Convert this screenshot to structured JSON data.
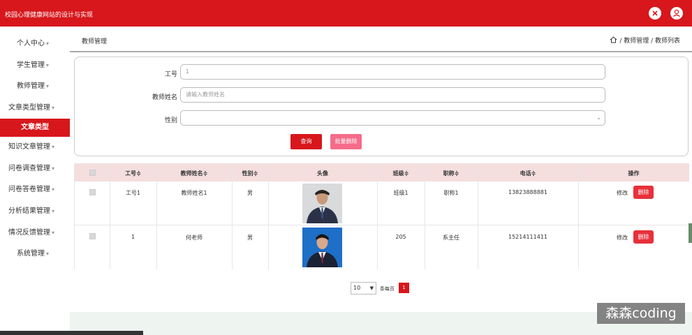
{
  "app": {
    "title": "校园心理健康网站的设计与实现",
    "close_icon": "close-icon",
    "user_icon": "user-icon"
  },
  "sidebar": {
    "items": [
      {
        "label": "个人中心",
        "arrow": "▾"
      },
      {
        "label": "学生管理",
        "arrow": "▾"
      },
      {
        "label": "教师管理",
        "arrow": "▾"
      },
      {
        "label": "文章类型管理",
        "arrow": "▾"
      },
      {
        "label": "文章类型",
        "arrow": ""
      },
      {
        "label": "知识文章管理",
        "arrow": "▾"
      },
      {
        "label": "问卷调查管理",
        "arrow": "▾"
      },
      {
        "label": "问卷答卷管理",
        "arrow": "▾"
      },
      {
        "label": "分析结果管理",
        "arrow": "▾"
      },
      {
        "label": "情况反馈管理",
        "arrow": "▾"
      },
      {
        "label": "系统管理",
        "arrow": "▾"
      }
    ]
  },
  "header": {
    "page_title": "教师管理",
    "breadcrumb": "/ 教师管理 / 教师列表"
  },
  "search": {
    "id_label": "工号",
    "id_value": "1",
    "name_label": "教师姓名",
    "name_placeholder": "请输入教师姓名",
    "gender_label": "性别",
    "gender_value": "",
    "query_button": "查询",
    "batch_delete_button": "批量删除"
  },
  "table": {
    "headers": [
      "工号≑",
      "教师姓名≑",
      "性别≑",
      "头像",
      "班级≑",
      "职称≑",
      "电话≑",
      "操作"
    ],
    "rows": [
      {
        "id": "工号1",
        "name": "教师姓名1",
        "gender": "男",
        "class": "班级1",
        "title": "职称1",
        "phone": "13823888881",
        "edit": "修改",
        "delete": "删除"
      },
      {
        "id": "1",
        "name": "何老师",
        "gender": "男",
        "class": "205",
        "title": "系主任",
        "phone": "15214111411",
        "edit": "修改",
        "delete": "删除"
      }
    ]
  },
  "pagination": {
    "page_size": "10",
    "per_page_label": "条每页",
    "current_page": "1"
  },
  "watermark": "森森coding",
  "colors": {
    "brand": "#d7171c",
    "delete": "#e8303a",
    "batch_delete": "#f56c8a",
    "header_row": "#f5dede"
  }
}
